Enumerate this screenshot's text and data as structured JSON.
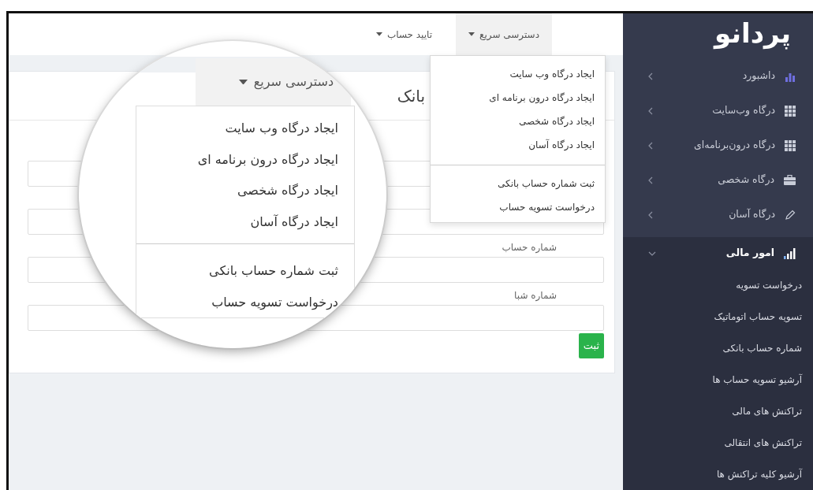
{
  "sidebar": {
    "logo": "پردانو",
    "items": [
      {
        "label": "داشبورد",
        "expanded": false,
        "selected": false
      },
      {
        "label": "درگاه وب‌سایت",
        "expanded": false,
        "selected": false
      },
      {
        "label": "درگاه درون‌برنامه‌ای",
        "expanded": false,
        "selected": false
      },
      {
        "label": "درگاه شخصی",
        "expanded": false,
        "selected": false
      },
      {
        "label": "درگاه آسان",
        "expanded": false,
        "selected": false
      },
      {
        "label": "امور مالی",
        "expanded": true,
        "selected": true,
        "children": [
          {
            "label": "درخواست تسویه"
          },
          {
            "label": "تسویه حساب اتوماتیک"
          },
          {
            "label": "شماره حساب بانکی"
          },
          {
            "label": "آرشیو تسویه حساب ها"
          },
          {
            "label": "تراکنش های مالی"
          },
          {
            "label": "تراکنش های انتقالی"
          },
          {
            "label": "آرشیو کلیه تراکنش ها"
          }
        ]
      }
    ]
  },
  "navbar": {
    "menus": [
      {
        "label": "دسترسی سریع",
        "open": true
      },
      {
        "label": "تایید حساب",
        "open": false
      }
    ]
  },
  "dropdown": {
    "groups": [
      [
        "ایجاد درگاه وب سایت",
        "ایجاد درگاه درون برنامه ای",
        "ایجاد درگاه شخصی",
        "ایجاد درگاه آسان"
      ],
      [
        "ثبت شماره حساب بانکی",
        "درخواست تسویه حساب"
      ]
    ]
  },
  "card": {
    "title": "بانک",
    "fields": [
      {
        "kind": "bare"
      },
      {
        "kind": "bare"
      },
      {
        "kind": "labeled",
        "label": "شماره حساب"
      },
      {
        "kind": "labeled",
        "label": "شماره شبا"
      }
    ],
    "submit": "ثبت"
  },
  "magnifier": {
    "button": "دسترسی سریع",
    "groups": [
      [
        "ایجاد درگاه وب سایت",
        "ایجاد درگاه درون برنامه ای",
        "ایجاد درگاه شخصی",
        "ایجاد درگاه آسان"
      ],
      [
        "ثبت شماره حساب بانکی",
        "درخواست تسویه حساب"
      ]
    ]
  }
}
